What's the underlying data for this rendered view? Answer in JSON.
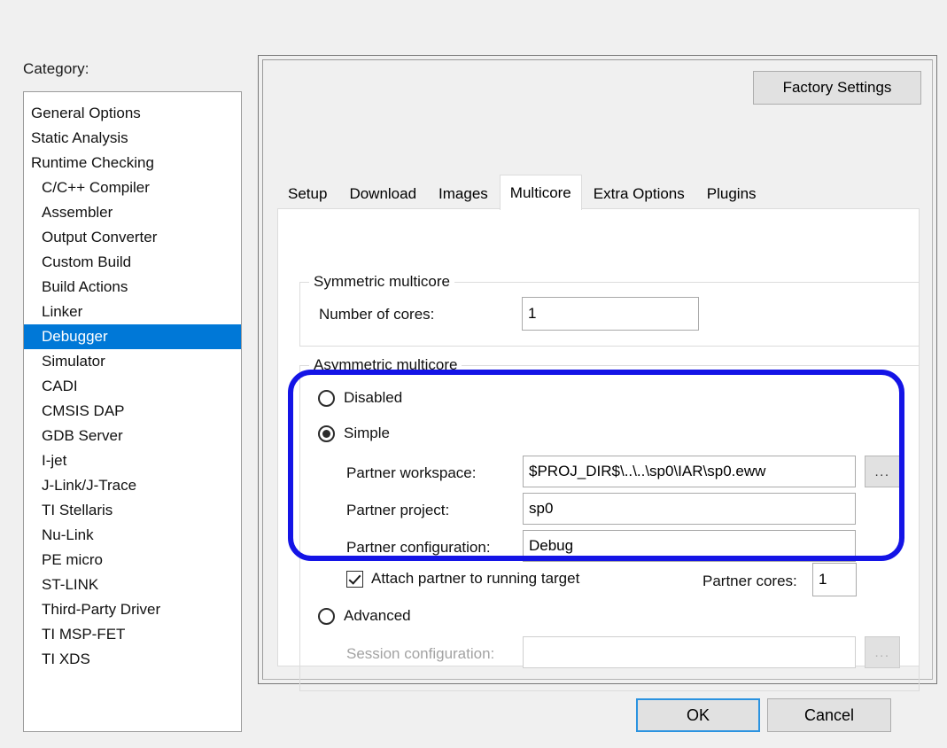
{
  "sidebar": {
    "label": "Category:",
    "items": [
      {
        "label": "General Options",
        "indent": false,
        "selected": false
      },
      {
        "label": "Static Analysis",
        "indent": false,
        "selected": false
      },
      {
        "label": "Runtime Checking",
        "indent": false,
        "selected": false
      },
      {
        "label": "C/C++ Compiler",
        "indent": true,
        "selected": false
      },
      {
        "label": "Assembler",
        "indent": true,
        "selected": false
      },
      {
        "label": "Output Converter",
        "indent": true,
        "selected": false
      },
      {
        "label": "Custom Build",
        "indent": true,
        "selected": false
      },
      {
        "label": "Build Actions",
        "indent": true,
        "selected": false
      },
      {
        "label": "Linker",
        "indent": true,
        "selected": false
      },
      {
        "label": "Debugger",
        "indent": true,
        "selected": true
      },
      {
        "label": "Simulator",
        "indent": true,
        "selected": false
      },
      {
        "label": "CADI",
        "indent": true,
        "selected": false
      },
      {
        "label": "CMSIS DAP",
        "indent": true,
        "selected": false
      },
      {
        "label": "GDB Server",
        "indent": true,
        "selected": false
      },
      {
        "label": "I-jet",
        "indent": true,
        "selected": false
      },
      {
        "label": "J-Link/J-Trace",
        "indent": true,
        "selected": false
      },
      {
        "label": "TI Stellaris",
        "indent": true,
        "selected": false
      },
      {
        "label": "Nu-Link",
        "indent": true,
        "selected": false
      },
      {
        "label": "PE micro",
        "indent": true,
        "selected": false
      },
      {
        "label": "ST-LINK",
        "indent": true,
        "selected": false
      },
      {
        "label": "Third-Party Driver",
        "indent": true,
        "selected": false
      },
      {
        "label": "TI MSP-FET",
        "indent": true,
        "selected": false
      },
      {
        "label": "TI XDS",
        "indent": true,
        "selected": false
      }
    ]
  },
  "panel": {
    "factory_settings_label": "Factory Settings",
    "tabs": [
      {
        "label": "Setup",
        "active": false
      },
      {
        "label": "Download",
        "active": false
      },
      {
        "label": "Images",
        "active": false
      },
      {
        "label": "Multicore",
        "active": true
      },
      {
        "label": "Extra Options",
        "active": false
      },
      {
        "label": "Plugins",
        "active": false
      }
    ]
  },
  "symmetric": {
    "legend": "Symmetric multicore",
    "number_of_cores_label": "Number of cores:",
    "number_of_cores_value": "1"
  },
  "asymmetric": {
    "legend": "Asymmetric multicore",
    "disabled_radio_label": "Disabled",
    "simple_radio_label": "Simple",
    "advanced_radio_label": "Advanced",
    "selected_mode": "Simple",
    "partner_workspace_label": "Partner workspace:",
    "partner_workspace_value": "$PROJ_DIR$\\..\\..\\sp0\\IAR\\sp0.eww",
    "partner_project_label": "Partner project:",
    "partner_project_value": "sp0",
    "partner_configuration_label": "Partner configuration:",
    "partner_configuration_value": "Debug",
    "attach_partner_label": "Attach partner to running target",
    "attach_partner_checked": true,
    "partner_cores_label": "Partner cores:",
    "partner_cores_value": "1",
    "session_configuration_label": "Session configuration:",
    "session_configuration_value": "",
    "browse_button_label": "...",
    "annotation_color": "#1414e6"
  },
  "footer": {
    "ok_label": "OK",
    "cancel_label": "Cancel"
  }
}
